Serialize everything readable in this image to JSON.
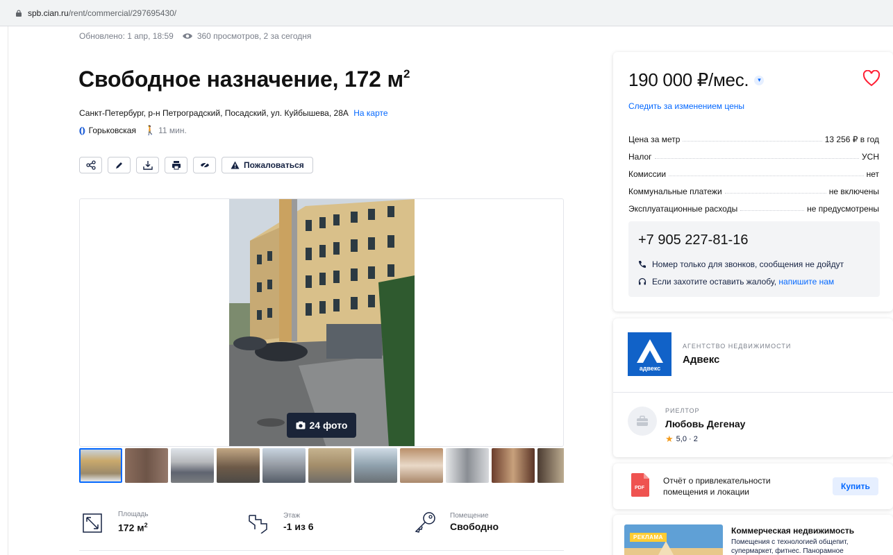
{
  "browser": {
    "url_host": "spb.cian.ru",
    "url_path": "/rent/commercial/297695430/"
  },
  "meta": {
    "updated": "Обновлено: 1 апр, 18:59",
    "views": "360 просмотров, 2 за сегодня"
  },
  "listing": {
    "title": "Свободное назначение, 172 м",
    "title_sup": "2",
    "address": "Санкт-Петербург, р-н Петроградский, Посадский, ул. Куйбышева, 28А",
    "map_link": "На карте",
    "metro_station": "Горьковская",
    "metro_time": "11 мин."
  },
  "toolbar": {
    "share_icon": "share-icon",
    "edit_icon": "pencil-icon",
    "download_icon": "download-icon",
    "print_icon": "print-icon",
    "hide_icon": "hide-icon",
    "report_label": "Пожаловаться"
  },
  "gallery": {
    "photo_count_label": "24 фото",
    "thumbnail_count": 11
  },
  "features": [
    {
      "label": "Площадь",
      "value": "172 м",
      "value_sup": "2",
      "icon": "area-icon"
    },
    {
      "label": "Этаж",
      "value": "-1 из 6",
      "icon": "stairs-icon"
    },
    {
      "label": "Помещение",
      "value": "Свободно",
      "icon": "key-icon"
    }
  ],
  "price_card": {
    "price": "190 000 ₽/мес.",
    "watch_price": "Следить за изменением цены",
    "rows": [
      {
        "label": "Цена за метр",
        "value": "13 256 ₽ в год"
      },
      {
        "label": "Налог",
        "value": "УСН"
      },
      {
        "label": "Комиссии",
        "value": "нет"
      },
      {
        "label": "Коммунальные платежи",
        "value": "не включены"
      },
      {
        "label": "Эксплуатационные расходы",
        "value": "не предусмотрены"
      }
    ],
    "phone": "+7 905 227-81-16",
    "phone_note": "Номер только для звонков, сообщения не дойдут",
    "complaint_text": "Если захотите оставить жалобу,",
    "complaint_link": "напишите нам"
  },
  "agent": {
    "agency_type": "АГЕНТСТВО НЕДВИЖИМОСТИ",
    "agency_name": "Адвекс",
    "agency_logo_text": "адвекс",
    "realtor_type": "РИЕЛТОР",
    "realtor_name": "Любовь Дегенау",
    "rating": "5,0 · 2"
  },
  "report": {
    "pdf_label": "PDF",
    "text": "Отчёт о привлекательности помещения и локации",
    "buy_label": "Купить"
  },
  "ad": {
    "badge": "РЕКЛАМА",
    "title": "Коммерческая недвижимость",
    "text": "Помещения с технологией общепит, супермаркет, фитнес. Панорамное"
  },
  "colors": {
    "accent": "#0468ff",
    "heart": "#ff1f34",
    "title": "#121212",
    "muted": "#7a7f8a",
    "count_badge": "#1a2438"
  }
}
